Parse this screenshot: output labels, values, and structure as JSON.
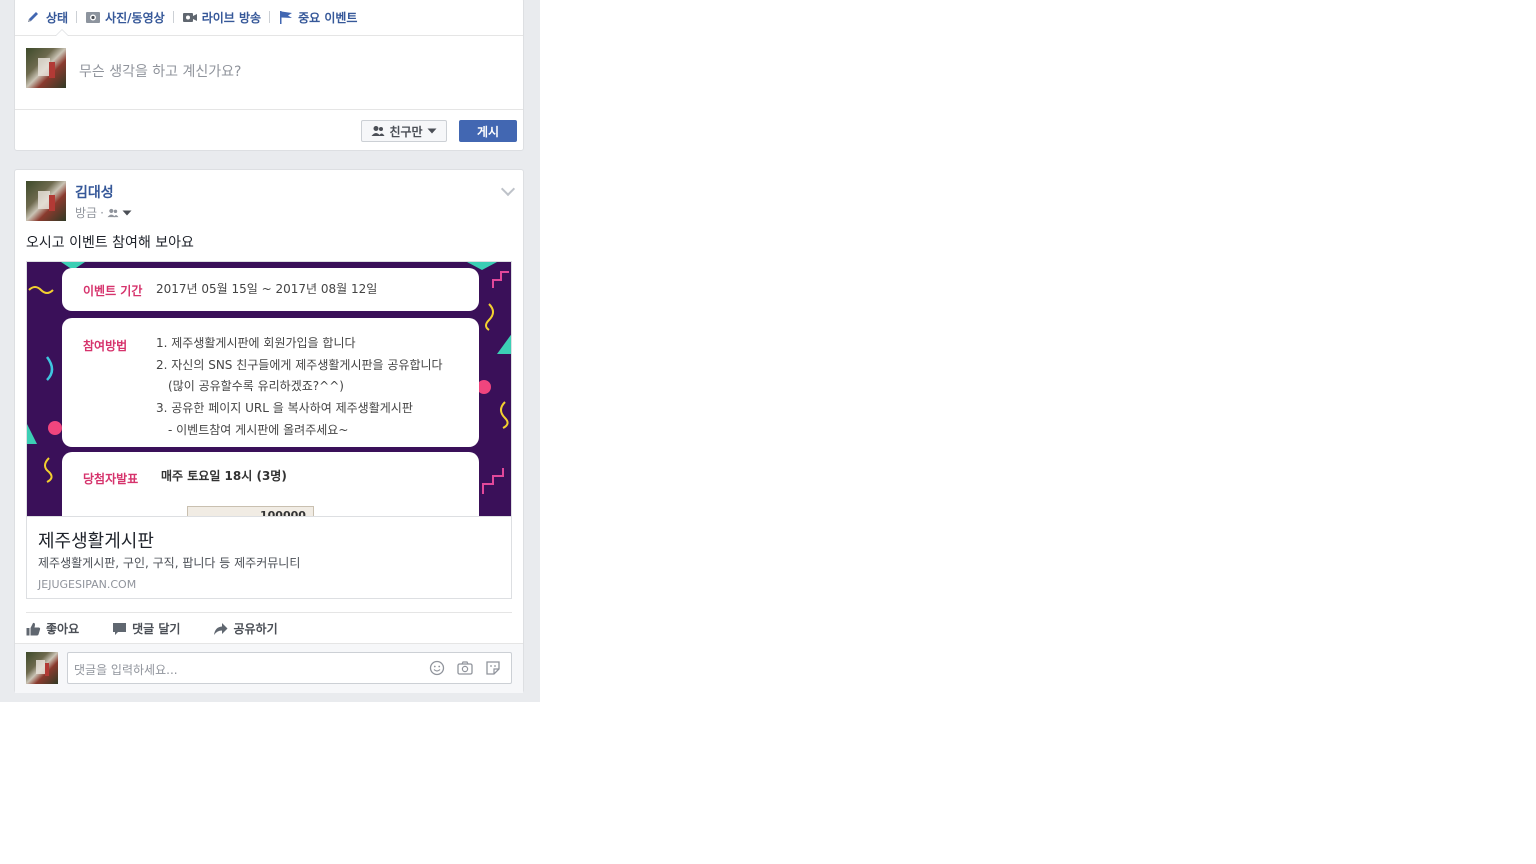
{
  "composer": {
    "tabs": [
      {
        "label": "상태",
        "icon": "pencil-icon"
      },
      {
        "label": "사진/동영상",
        "icon": "camera-icon"
      },
      {
        "label": "라이브 방송",
        "icon": "video-camera-icon"
      },
      {
        "label": "중요 이벤트",
        "icon": "flag-icon"
      }
    ],
    "placeholder": "무슨 생각을 하고 계신가요?",
    "audience_label": "친구만",
    "post_label": "게시"
  },
  "post": {
    "author": "김대성",
    "timestamp": "방금",
    "meta_sep": "·",
    "text": "오시고 이벤트 참여해 보아요",
    "banner": {
      "period_label": "이벤트 기간",
      "period_value": "2017년 05월 15일 ~ 2017년 08월 12일",
      "method_label": "참여방법",
      "method_lines": [
        "1. 제주생활게시판에 회원가입을 합니다",
        "2. 자신의 SNS 친구들에게 제주생활게시판을 공유합니다",
        "(많이 공유할수록 유리하겠죠?^^)",
        "3. 공유한 페이지 URL 을 복사하여 제주생활게시판",
        "- 이벤트참여 게시판에 올려주세요~"
      ],
      "winner_label": "당첨자발표",
      "winner_value": "매주 토요일 18시 (3명)",
      "partial_text": "100000"
    },
    "link": {
      "title": "제주생활게시판",
      "description": "제주생활게시판, 구인, 구직, 팝니다 등 제주커뮤니티",
      "domain": "JEJUGESIPAN.COM"
    },
    "actions": {
      "like": "좋아요",
      "comment": "댓글 달기",
      "share": "공유하기"
    },
    "comment_placeholder": "댓글을 입력하세요..."
  },
  "colors": {
    "link_blue": "#365899",
    "button_blue": "#4267b2",
    "banner_purple": "#3a1059",
    "banner_accent": "#d6336c",
    "page_bg": "#e9ebee"
  }
}
